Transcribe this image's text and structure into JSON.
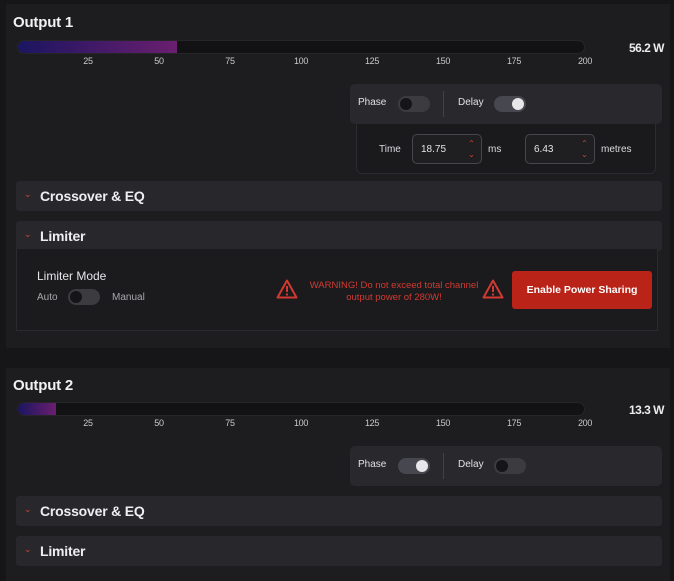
{
  "colors": {
    "accent": "#c8281d",
    "warning": "#d23a31",
    "meter_start": "#1b1560",
    "meter_end": "#6a1f6f"
  },
  "meter_ticks": [
    "25",
    "50",
    "75",
    "100",
    "125",
    "150",
    "175",
    "200"
  ],
  "outputs": [
    {
      "title": "Output 1",
      "power_label": "56.2 W",
      "power_watts": 56.2,
      "meter_max": 200,
      "phase_label": "Phase",
      "phase_on": false,
      "delay_label": "Delay",
      "delay_on": true,
      "time_label": "Time",
      "time_value": "18.75",
      "time_unit": "ms",
      "distance_value": "6.43",
      "distance_unit": "metres",
      "crossover_label": "Crossover & EQ",
      "limiter_label": "Limiter",
      "limiter_mode_title": "Limiter Mode",
      "limiter_mode_auto": "Auto",
      "limiter_mode_manual": "Manual",
      "limiter_manual": false,
      "warning_text": "WARNING! Do not exceed total channel output power of 280W!",
      "power_sharing_button": "Enable Power Sharing"
    },
    {
      "title": "Output 2",
      "power_label": "13.3 W",
      "power_watts": 13.3,
      "meter_max": 200,
      "phase_label": "Phase",
      "phase_on": true,
      "delay_label": "Delay",
      "delay_on": false,
      "crossover_label": "Crossover & EQ",
      "limiter_label": "Limiter"
    }
  ]
}
